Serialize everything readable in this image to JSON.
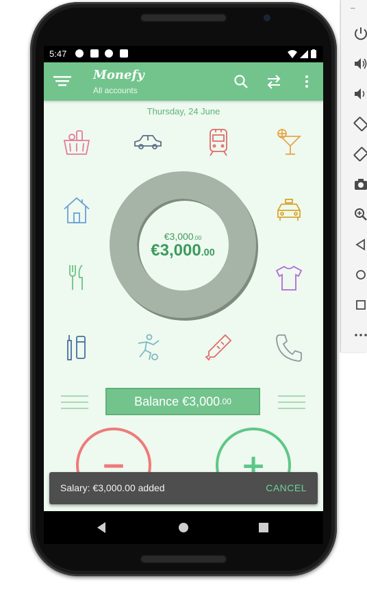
{
  "status_bar": {
    "time": "5:47"
  },
  "app": {
    "title": "Monefy",
    "subtitle": "All accounts"
  },
  "date": "Thursday, 24 June",
  "categories": [
    {
      "name": "groceries",
      "icon": "shopping-basket-icon",
      "color": "#e57a9a"
    },
    {
      "name": "car",
      "icon": "car-icon",
      "color": "#5a6e86"
    },
    {
      "name": "transport",
      "icon": "train-icon",
      "color": "#e06a6a"
    },
    {
      "name": "entertainment",
      "icon": "cocktail-icon",
      "color": "#e8a64a"
    },
    {
      "name": "house",
      "icon": "house-icon",
      "color": "#6a9fd6"
    },
    {
      "name": "taxi",
      "icon": "taxi-icon",
      "color": "#d9a62a"
    },
    {
      "name": "eating-out",
      "icon": "fork-knife-icon",
      "color": "#6cc08a"
    },
    {
      "name": "clothes",
      "icon": "tshirt-icon",
      "color": "#b06ad6"
    },
    {
      "name": "toiletry",
      "icon": "toothbrush-icon",
      "color": "#466f9e"
    },
    {
      "name": "sports",
      "icon": "football-player-icon",
      "color": "#7db8c2"
    },
    {
      "name": "health",
      "icon": "thermometer-icon",
      "color": "#e06a6a"
    },
    {
      "name": "communications",
      "icon": "phone-icon",
      "color": "#8a9aa0"
    }
  ],
  "chart": {
    "income": "€3,000",
    "income_cents": ".00",
    "balance": "€3,000",
    "balance_cents": ".00",
    "ring_color": "#a6b3a7"
  },
  "balance_button": {
    "label": "Balance €3,000",
    "cents": ".00"
  },
  "buttons": {
    "expense_glyph": "−",
    "income_glyph": "+"
  },
  "snackbar": {
    "message": "Salary: €3,000.00 added",
    "action": "CANCEL"
  },
  "colors": {
    "accent": "#72c48c",
    "expense": "#ef7a7a",
    "income": "#5ec788"
  }
}
